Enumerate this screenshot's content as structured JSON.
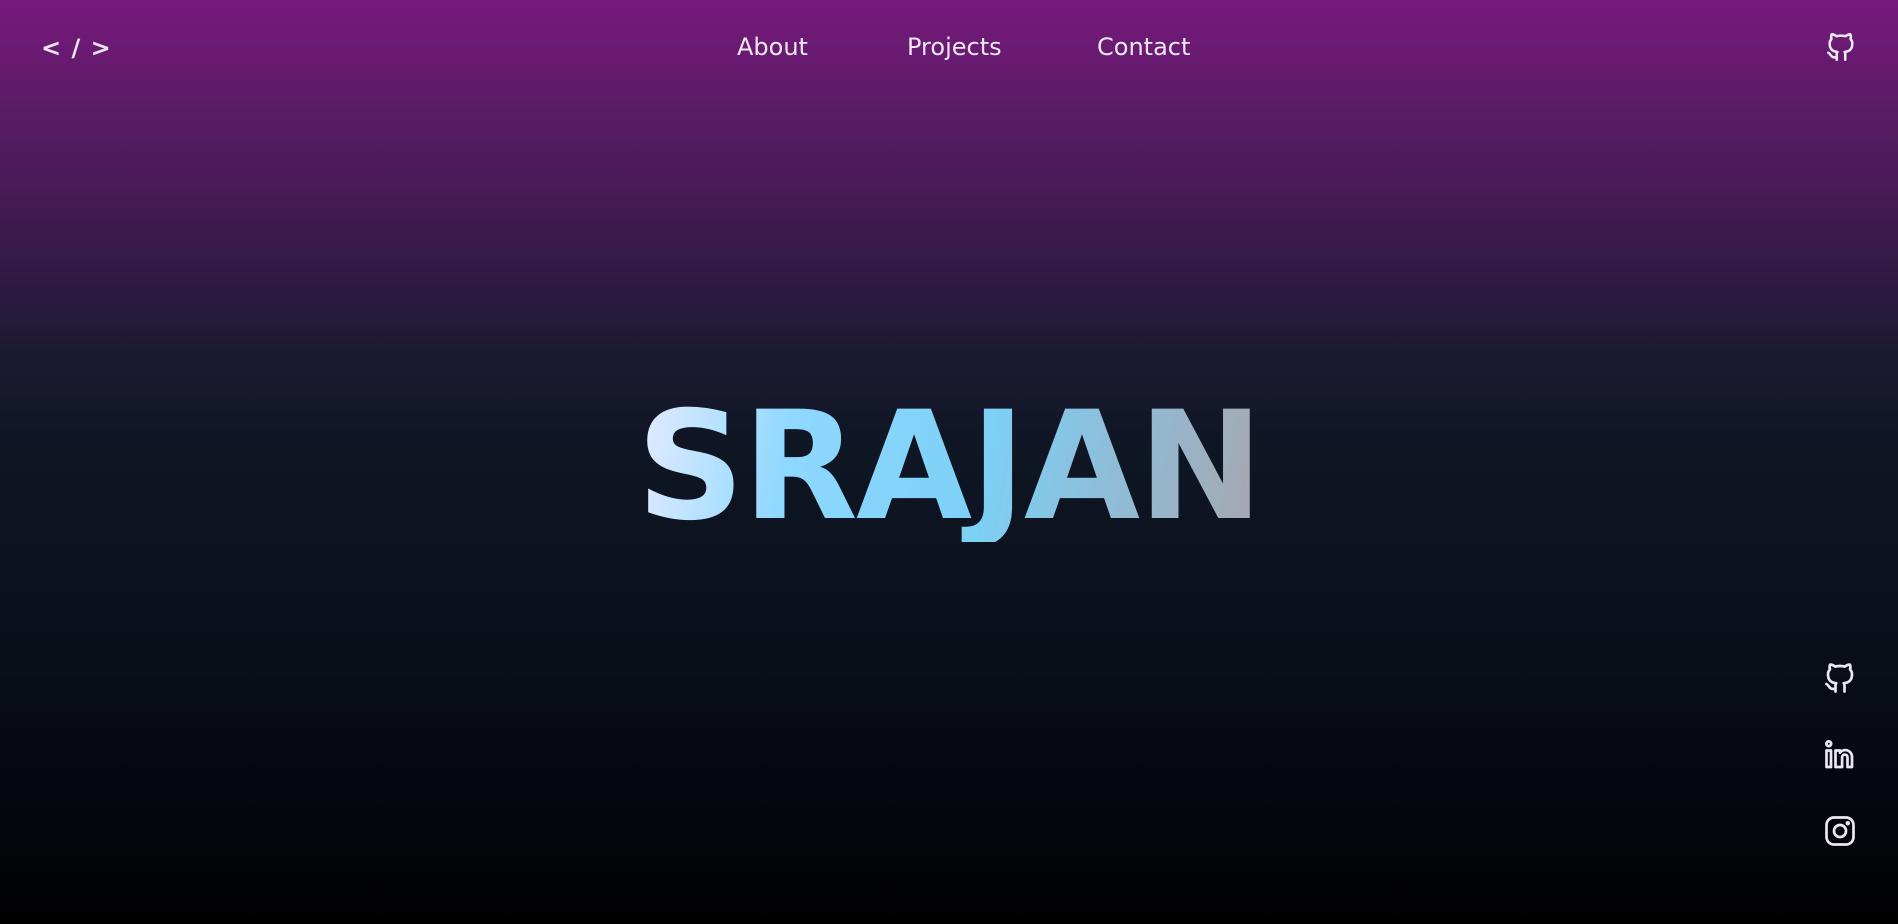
{
  "nav": {
    "logo": "< / >",
    "links": [
      {
        "label": "About"
      },
      {
        "label": "Projects"
      },
      {
        "label": "Contact"
      }
    ],
    "github_icon": "github-icon"
  },
  "hero": {
    "title": "SRAJAN"
  },
  "socials": [
    {
      "name": "github",
      "icon": "github-icon"
    },
    {
      "name": "linkedin",
      "icon": "linkedin-icon"
    },
    {
      "name": "instagram",
      "icon": "instagram-icon"
    }
  ],
  "colors": {
    "background_top": "#771a7c",
    "background_mid": "#0f1624",
    "background_bottom": "#010102",
    "title_gradient_start": "#e6ecff",
    "title_gradient_mid": "#7dd0f6",
    "title_gradient_end": "#a9a6ad",
    "text": "#ece8f2"
  }
}
